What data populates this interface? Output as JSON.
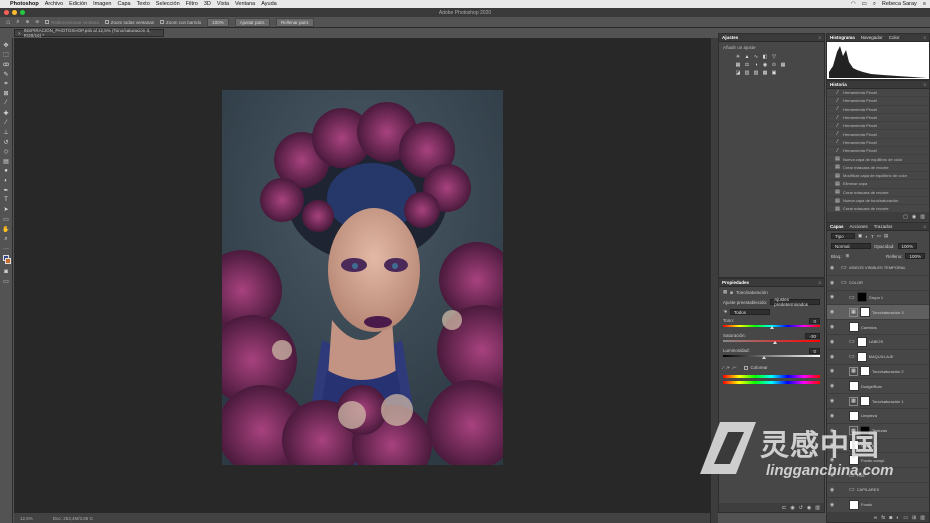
{
  "menubar": {
    "apple_icon": "apple-icon",
    "app_name": "Photoshop",
    "items": [
      "Archivo",
      "Edición",
      "Imagen",
      "Capa",
      "Texto",
      "Selección",
      "Filtro",
      "3D",
      "Vista",
      "Ventana",
      "Ayuda"
    ],
    "user": "Rebeca Saray"
  },
  "titlebar": {
    "title": "Adobe Photoshop 2020"
  },
  "options": {
    "size": "30",
    "sample_label": "Muestrear todas las capas",
    "auto_enhance_label": "Autoaumentar",
    "buttons": [
      "Seleccionar sujeto",
      "Seleccionar y aplicar máscara..."
    ],
    "zoom_label": "Redimensionar ventana",
    "fit_label": "Zoom todas ventanas",
    "scrubby_label": "Zoom con barrido",
    "btn_100": "100%",
    "btn_fit": "Ajustar pant.",
    "btn_fill": "Rellenar pant."
  },
  "document": {
    "tab_label": "INSPIRACIÓN_PHOTOSHOP.psb al 12,5% (Tono/saturación 3, RGB/16) *"
  },
  "status": {
    "zoom": "12,5%",
    "doc": "Doc: 263,4M/3,85 G"
  },
  "ajustes": {
    "tabs": [
      "Ajustes"
    ],
    "subtitle": "Añadir un ajuste"
  },
  "propiedades": {
    "tab": "Propiedades",
    "type_label": "Tono/saturación",
    "preset_label": "Ajuste preestablecido:",
    "preset_value": "Ajustes predeterminados",
    "channel_value": "Todos",
    "tono_label": "Tono:",
    "tono_value": "0",
    "saturacion_label": "Saturación:",
    "saturacion_value": "-30",
    "luminosidad_label": "Luminosidad:",
    "luminosidad_value": "0",
    "colorize_label": "Colorear"
  },
  "histograma": {
    "tabs": [
      "Histograma",
      "Navegador",
      "Color"
    ]
  },
  "historia": {
    "tab": "Historia",
    "items": [
      "Herramienta Pincel",
      "Herramienta Pincel",
      "Herramienta Pincel",
      "Herramienta Pincel",
      "Herramienta Pincel",
      "Herramienta Pincel",
      "Herramienta Pincel",
      "Herramienta Pincel",
      "Nueva capa de equilibrio de color",
      "Crear máscara de recorte",
      "Modificar capa de equilibrio de color",
      "Eliminar capa",
      "Crear máscara de recorte",
      "Nueva capa de tono/saturación",
      "Crear máscara de recorte",
      "Modificar capa de tono/saturación"
    ]
  },
  "capas": {
    "tabs": [
      "Capas",
      "Acciones",
      "Trazados"
    ],
    "filter_value": "Tipo",
    "blend_mode": "Normal",
    "opacity_label": "Opacidad:",
    "opacity_value": "100%",
    "lock_label": "Bloq.:",
    "fill_label": "Relleno:",
    "fill_value": "100%",
    "layers": [
      {
        "name": "VIDEOS VISIBLES TEMPORAL",
        "kind": "folder"
      },
      {
        "name": "COLOR",
        "kind": "folder"
      },
      {
        "name": "Grupo 1",
        "kind": "folder-mask"
      },
      {
        "name": "Tono/saturación 3",
        "kind": "adj",
        "selected": true
      },
      {
        "name": "Cambios",
        "kind": "pixel"
      },
      {
        "name": "LABIOS",
        "kind": "folder-mask"
      },
      {
        "name": "MAQUILLAJE",
        "kind": "folder-mask"
      },
      {
        "name": "Tono/saturación 2",
        "kind": "adj"
      },
      {
        "name": "Dodge/Burn",
        "kind": "pixel"
      },
      {
        "name": "Tono/saturación 1",
        "kind": "adj"
      },
      {
        "name": "Limpieza",
        "kind": "pixel"
      },
      {
        "name": "Texturas",
        "kind": "adj-black"
      },
      {
        "name": "Capa 1",
        "kind": "pixel"
      },
      {
        "name": "Fondo compl.",
        "kind": "pixel"
      },
      {
        "name": "PIEL",
        "kind": "folder"
      },
      {
        "name": "CAPILARES",
        "kind": "folder"
      },
      {
        "name": "Fondo",
        "kind": "pixel"
      }
    ]
  },
  "watermark": {
    "cn": "灵感中国",
    "url": "lingganchina.com"
  },
  "colors": {
    "ui_bg": "#535353",
    "panel_bg": "#474747",
    "canvas_bg": "#282828"
  }
}
